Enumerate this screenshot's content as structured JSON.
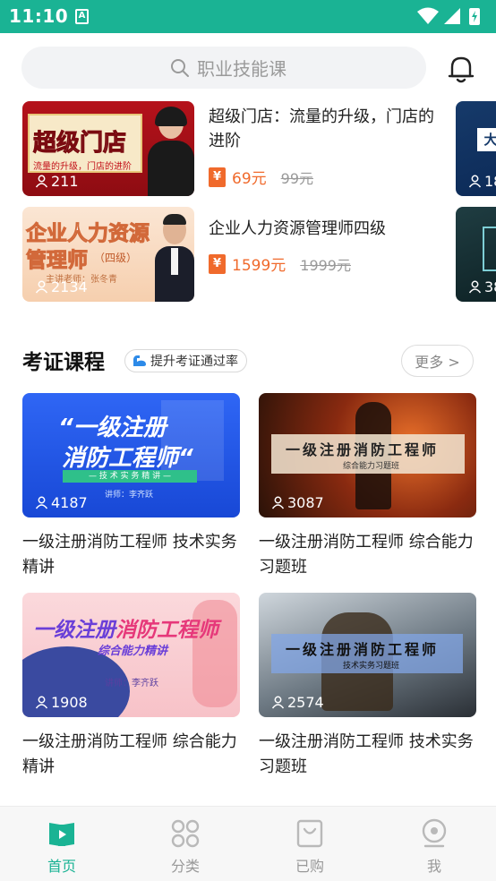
{
  "status_bar": {
    "time": "11:10",
    "app_icon_letter": "A"
  },
  "search": {
    "placeholder": "职业技能课"
  },
  "courses": [
    {
      "title": "超级门店：流量的升级，门店的进阶",
      "price": "69元",
      "old_price": "99元",
      "learners": "211",
      "thumb_text": "超级门店",
      "thumb_sub": "流量的升级，门店的进阶"
    },
    {
      "title": "企业人力资源管理师四级",
      "price": "1599元",
      "old_price": "1999元",
      "learners": "2134",
      "thumb_text_1": "企业人力资源",
      "thumb_text_2": "管理师",
      "thumb_level": "（四级）",
      "thumb_teacher": "主讲老师：张冬青"
    }
  ],
  "edge_cards": [
    {
      "learners": "18",
      "thumb_text": "大"
    },
    {
      "learners": "38"
    }
  ],
  "section": {
    "title": "考证课程",
    "tag": "提升考证通过率",
    "more": "更多 >"
  },
  "grid": [
    {
      "title": "一级注册消防工程师 技术实务精讲",
      "learners": "4187",
      "t1": "“一级注册",
      "t2": "消防工程师“",
      "t3": "— 技 术 实 务 精 讲 —",
      "t4": "讲师：李齐跃"
    },
    {
      "title": " 一级注册消防工程师 综合能力习题班",
      "learners": "3087",
      "t1": "一级注册消防工程师",
      "t2": "综合能力习题班"
    },
    {
      "title": "一级注册消防工程师 综合能力精讲",
      "learners": "1908",
      "t1": "一级注册",
      "t1b": "消防工程师",
      "t2": "综合能力精讲",
      "t3": "讲师：李齐跃"
    },
    {
      "title": "一级注册消防工程师 技术实务习题班",
      "learners": "2574",
      "t1": "一级注册消防工程师",
      "t2": "技术实务习题班"
    }
  ],
  "tabs": [
    {
      "label": "首页",
      "icon": "home-book-icon"
    },
    {
      "label": "分类",
      "icon": "category-grid-icon"
    },
    {
      "label": "已购",
      "icon": "purchased-bag-icon"
    },
    {
      "label": "我",
      "icon": "profile-icon"
    }
  ],
  "colors": {
    "accent": "#1ab394",
    "price": "#f06a2c",
    "inactive": "#999999"
  }
}
